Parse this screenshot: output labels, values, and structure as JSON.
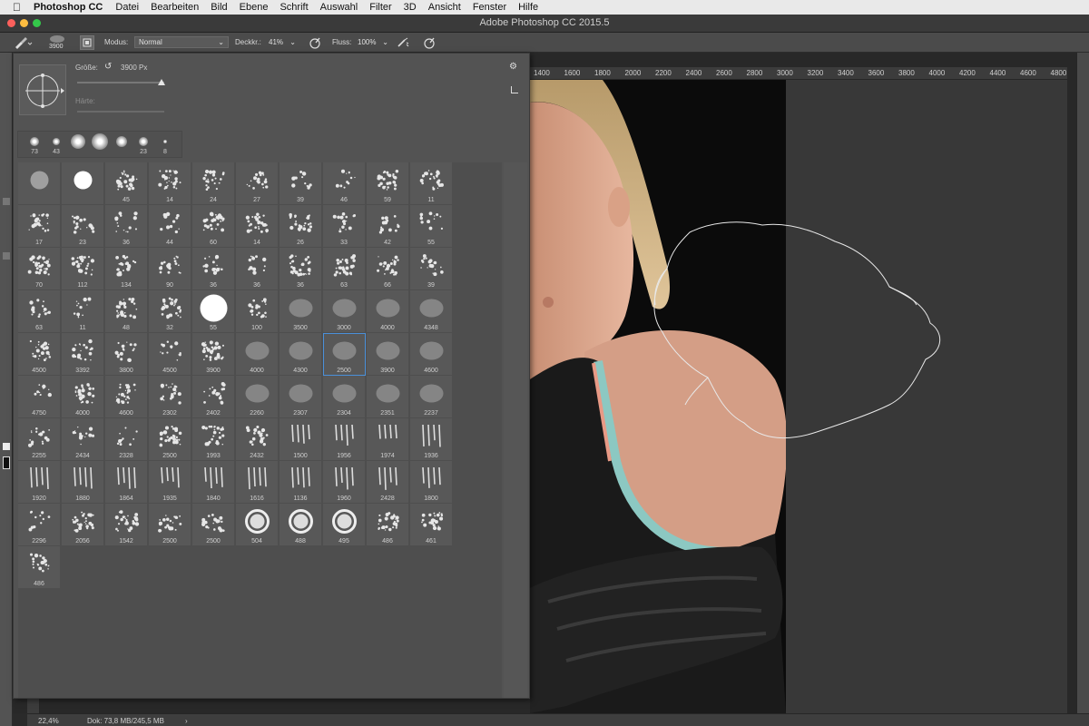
{
  "menubar": {
    "app_name": "Photoshop CC",
    "items": [
      "Datei",
      "Bearbeiten",
      "Bild",
      "Ebene",
      "Schrift",
      "Auswahl",
      "Filter",
      "3D",
      "Ansicht",
      "Fenster",
      "Hilfe"
    ]
  },
  "window": {
    "title": "Adobe Photoshop CC 2015.5"
  },
  "options_bar": {
    "brush_size": "3900",
    "mode_label": "Modus:",
    "mode_value": "Normal",
    "opacity_label": "Deckkr.:",
    "opacity_value": "41%",
    "flow_label": "Fluss:",
    "flow_value": "100%"
  },
  "brush_panel": {
    "size_label": "Größe:",
    "size_value": "3900 Px",
    "size_fraction": 0.97,
    "hardness_label": "Härte:",
    "recent_sizes": [
      "73",
      "43",
      "",
      "",
      "",
      "23",
      "8"
    ],
    "selected_index": 47,
    "presets": [
      "",
      "",
      "45",
      "14",
      "24",
      "27",
      "39",
      "46",
      "59",
      "11",
      "17",
      "23",
      "36",
      "44",
      "60",
      "14",
      "26",
      "33",
      "42",
      "55",
      "70",
      "112",
      "134",
      "90",
      "36",
      "36",
      "36",
      "63",
      "66",
      "39",
      "63",
      "11",
      "48",
      "32",
      "55",
      "100",
      "3500",
      "3000",
      "4000",
      "4348",
      "4500",
      "3392",
      "3800",
      "4500",
      "3900",
      "4000",
      "4300",
      "2500",
      "3900",
      "4600",
      "4750",
      "4000",
      "4600",
      "2302",
      "2402",
      "2260",
      "2307",
      "2304",
      "2351",
      "2237",
      "2255",
      "2434",
      "2328",
      "2500",
      "1993",
      "2432",
      "1500",
      "1956",
      "1974",
      "1936",
      "1920",
      "1880",
      "1864",
      "1935",
      "1840",
      "1616",
      "1136",
      "1960",
      "2428",
      "1800",
      "2296",
      "2056",
      "1542",
      "2500",
      "2500",
      "504",
      "488",
      "495",
      "486",
      "461",
      "486"
    ]
  },
  "ruler_top": [
    "1400",
    "1600",
    "1800",
    "2000",
    "2200",
    "2400",
    "2600",
    "2800",
    "3000",
    "3200",
    "3400",
    "3600",
    "3800",
    "4000",
    "4200",
    "4400",
    "4600",
    "4800"
  ],
  "statusbar": {
    "zoom": "22,4%",
    "doc": "Dok: 73,8 MB/245,5 MB"
  },
  "colors": {
    "menubar_bg": "#e9e9e9",
    "panel_bg": "#535353",
    "selection_blue": "#4a90d9",
    "close": "#fc605c",
    "minimize": "#fdbc40",
    "zoom": "#34c84a"
  }
}
